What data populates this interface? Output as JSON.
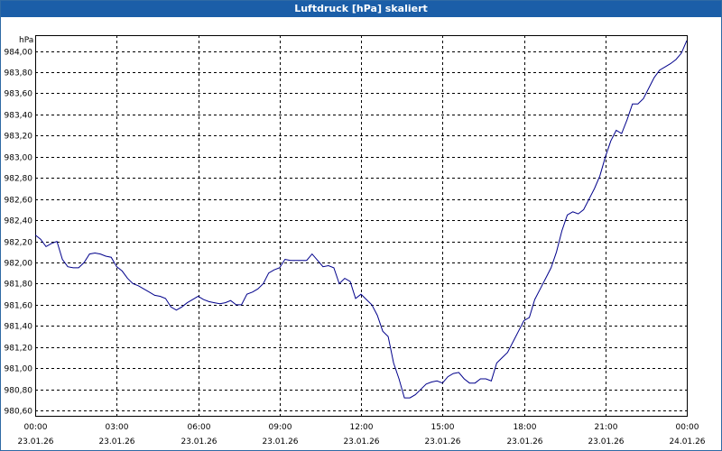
{
  "chart_data": {
    "type": "line",
    "title": "Luftdruck [hPa] skaliert",
    "ylabel": "hPa",
    "xlabel": "",
    "grid": true,
    "ylim": [
      980.55,
      984.15
    ],
    "yticks": [
      "984,00",
      "983,80",
      "983,60",
      "983,40",
      "983,20",
      "983,00",
      "982,80",
      "982,60",
      "982,40",
      "982,20",
      "982,00",
      "981,80",
      "981,60",
      "981,40",
      "981,20",
      "981,00",
      "980,80",
      "980,60"
    ],
    "ytick_values": [
      984.0,
      983.8,
      983.6,
      983.4,
      983.2,
      983.0,
      982.8,
      982.6,
      982.4,
      982.2,
      982.0,
      981.8,
      981.6,
      981.4,
      981.2,
      981.0,
      980.8,
      980.6
    ],
    "xlim": [
      0,
      24
    ],
    "xticks": [
      {
        "x": 0,
        "time": "00:00",
        "date": "23.01.26"
      },
      {
        "x": 3,
        "time": "03:00",
        "date": "23.01.26"
      },
      {
        "x": 6,
        "time": "06:00",
        "date": "23.01.26"
      },
      {
        "x": 9,
        "time": "09:00",
        "date": "23.01.26"
      },
      {
        "x": 12,
        "time": "12:00",
        "date": "23.01.26"
      },
      {
        "x": 15,
        "time": "15:00",
        "date": "23.01.26"
      },
      {
        "x": 18,
        "time": "18:00",
        "date": "23.01.26"
      },
      {
        "x": 21,
        "time": "21:00",
        "date": "23.01.26"
      },
      {
        "x": 24,
        "time": "00:00",
        "date": "24.01.26"
      }
    ],
    "line_color": "#00008b",
    "series": [
      {
        "x": [
          0,
          0.2,
          0.4,
          0.6,
          0.8,
          1.0,
          1.2,
          1.4,
          1.6,
          1.8,
          2.0,
          2.2,
          2.4,
          2.6,
          2.8,
          3.0,
          3.2,
          3.4,
          3.6,
          3.8,
          4.0,
          4.2,
          4.4,
          4.6,
          4.8,
          5.0,
          5.2,
          5.4,
          5.6,
          5.8,
          6.0,
          6.2,
          6.4,
          6.6,
          6.8,
          7.0,
          7.2,
          7.4,
          7.6,
          7.8,
          8.0,
          8.2,
          8.4,
          8.6,
          8.8,
          9.0,
          9.2,
          9.4,
          9.6,
          9.8,
          10.0,
          10.2,
          10.4,
          10.6,
          10.8,
          11.0,
          11.2,
          11.4,
          11.6,
          11.8,
          12.0,
          12.2,
          12.4,
          12.6,
          12.8,
          13.0,
          13.2,
          13.4,
          13.6,
          13.8,
          14.0,
          14.2,
          14.4,
          14.6,
          14.8,
          15.0,
          15.2,
          15.4,
          15.6,
          15.8,
          16.0,
          16.2,
          16.4,
          16.6,
          16.8,
          17.0,
          17.2,
          17.4,
          17.6,
          17.8,
          18.0,
          18.2,
          18.4,
          18.6,
          18.8,
          19.0,
          19.2,
          19.4,
          19.6,
          19.8,
          20.0,
          20.2,
          20.4,
          20.6,
          20.8,
          21.0,
          21.2,
          21.4,
          21.6,
          21.8,
          22.0,
          22.2,
          22.4,
          22.6,
          22.8,
          23.0,
          23.2,
          23.4,
          23.6,
          23.8,
          24.0
        ],
        "values": [
          982.26,
          982.22,
          982.15,
          982.18,
          982.2,
          982.03,
          981.96,
          981.95,
          981.95,
          982.0,
          982.08,
          982.09,
          982.08,
          982.06,
          982.05,
          981.96,
          981.92,
          981.85,
          981.8,
          981.78,
          981.75,
          981.72,
          981.69,
          981.68,
          981.66,
          981.58,
          981.55,
          981.58,
          981.62,
          981.65,
          981.68,
          981.65,
          981.63,
          981.62,
          981.61,
          981.62,
          981.64,
          981.6,
          981.6,
          981.7,
          981.72,
          981.75,
          981.8,
          981.9,
          981.93,
          981.95,
          982.03,
          982.02,
          982.02,
          982.02,
          982.02,
          982.08,
          982.02,
          981.96,
          981.97,
          981.95,
          981.8,
          981.85,
          981.82,
          981.66,
          981.7,
          981.65,
          981.6,
          981.5,
          981.35,
          981.3,
          981.05,
          980.9,
          980.72,
          980.72,
          980.75,
          980.8,
          980.85,
          980.87,
          980.88,
          980.86,
          980.92,
          980.95,
          980.96,
          980.9,
          980.86,
          980.86,
          980.9,
          980.9,
          980.88,
          981.05,
          981.1,
          981.15,
          981.25,
          981.35,
          981.45,
          981.48,
          981.65,
          981.75,
          981.85,
          981.95,
          982.1,
          982.3,
          982.45,
          982.48,
          982.46,
          982.5,
          982.6,
          982.7,
          982.82,
          983.0,
          983.15,
          983.25,
          983.22,
          983.35,
          983.5,
          983.5,
          983.55,
          983.65,
          983.75,
          983.82,
          983.85,
          983.88,
          983.92,
          983.98,
          984.1
        ]
      }
    ]
  }
}
